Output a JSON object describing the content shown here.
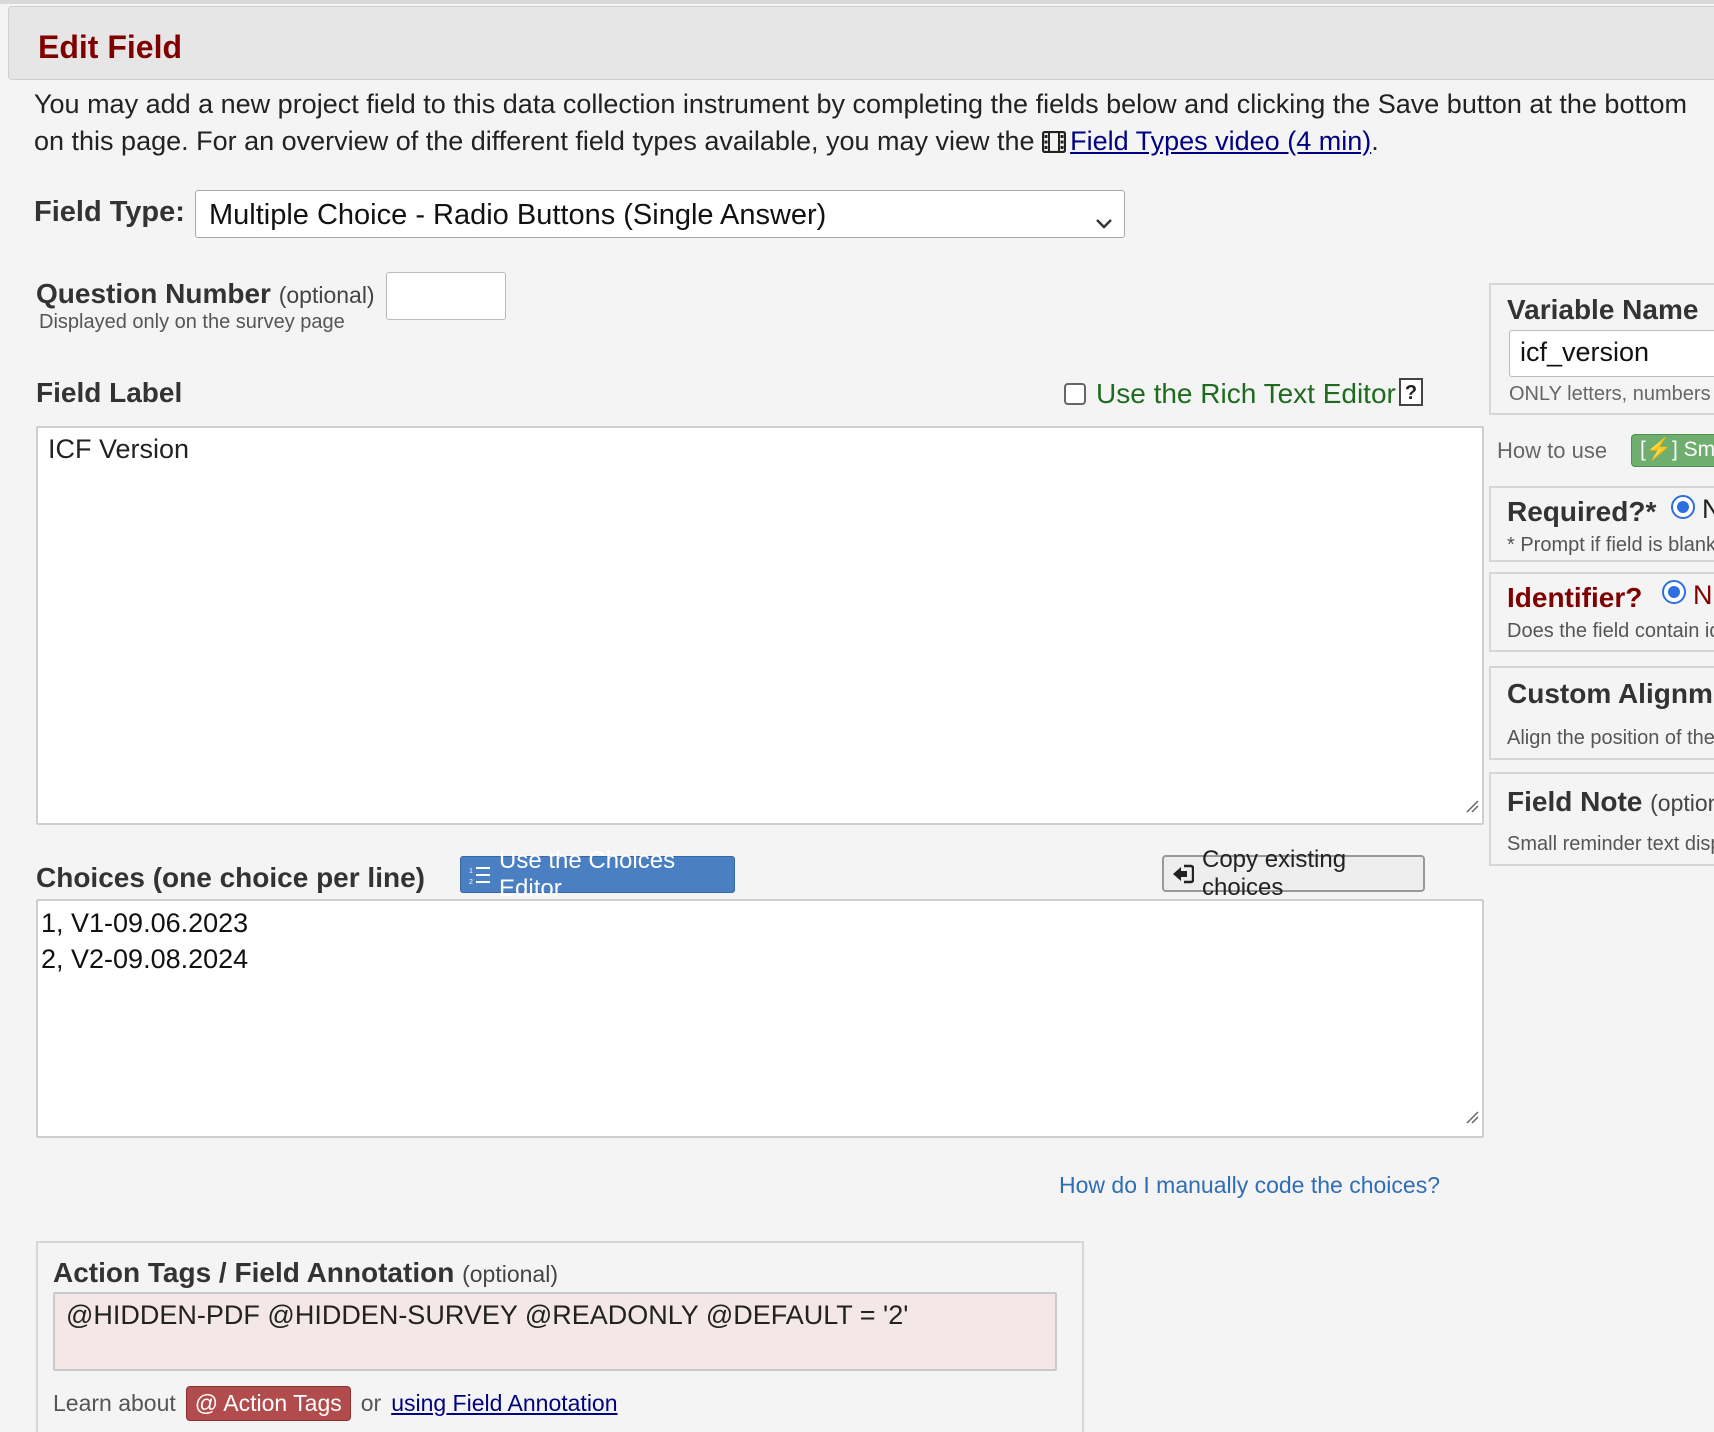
{
  "header": {
    "title": "Edit Field"
  },
  "intro": {
    "text": "You may add a new project field to this data collection instrument by completing the fields below and clicking the Save button at the bottom",
    "text2": "on this page. For an overview of the different field types available, you may view the",
    "video_link": "Field Types video (4 min)",
    "trailing": "."
  },
  "field_type": {
    "label": "Field Type:",
    "selected": "Multiple Choice - Radio Buttons (Single Answer)"
  },
  "question_number": {
    "label": "Question Number",
    "optional": "(optional)",
    "sublabel": "Displayed only on the survey page",
    "value": ""
  },
  "field_label": {
    "label": "Field Label",
    "rich_text_label": "Use the Rich Text Editor",
    "help": "?",
    "value": "ICF Version"
  },
  "choices": {
    "label": "Choices (one choice per line)",
    "editor_button": "Use the Choices Editor",
    "copy_button": "Copy existing choices",
    "lines": [
      "1, V1-09.06.2023",
      "2, V2-09.08.2024"
    ],
    "help_link": "How do I manually code the choices?"
  },
  "action_tags": {
    "label": "Action Tags / Field Annotation",
    "optional": "(optional)",
    "value": "@HIDDEN-PDF @HIDDEN-SURVEY @READONLY @DEFAULT = '2'",
    "learn_prefix": "Learn about",
    "badge": "@ Action Tags",
    "or": "or",
    "annotation_link": "using Field Annotation"
  },
  "right_panel": {
    "variable_name": {
      "label": "Variable Name",
      "value": "icf_version",
      "note": "ONLY letters, numbers"
    },
    "how_to_use": "How to use",
    "smart_badge": "[⚡] Sma",
    "required": {
      "label": "Required?*",
      "option": "N",
      "note": "* Prompt if field is blank"
    },
    "identifier": {
      "label": "Identifier?",
      "option": "N",
      "note": "Does the field contain id"
    },
    "custom_alignment": {
      "label": "Custom Alignme",
      "note": "Align the position of the"
    },
    "field_note": {
      "label": "Field Note",
      "optional": "(option",
      "note": "Small reminder text disp"
    }
  },
  "colors": {
    "title": "#800000",
    "link": "#000080",
    "rich_text": "#1e6b1e",
    "choices_button": "#4a7fc1",
    "action_badge": "#b24b4b",
    "smart_badge": "#6fae6f"
  }
}
